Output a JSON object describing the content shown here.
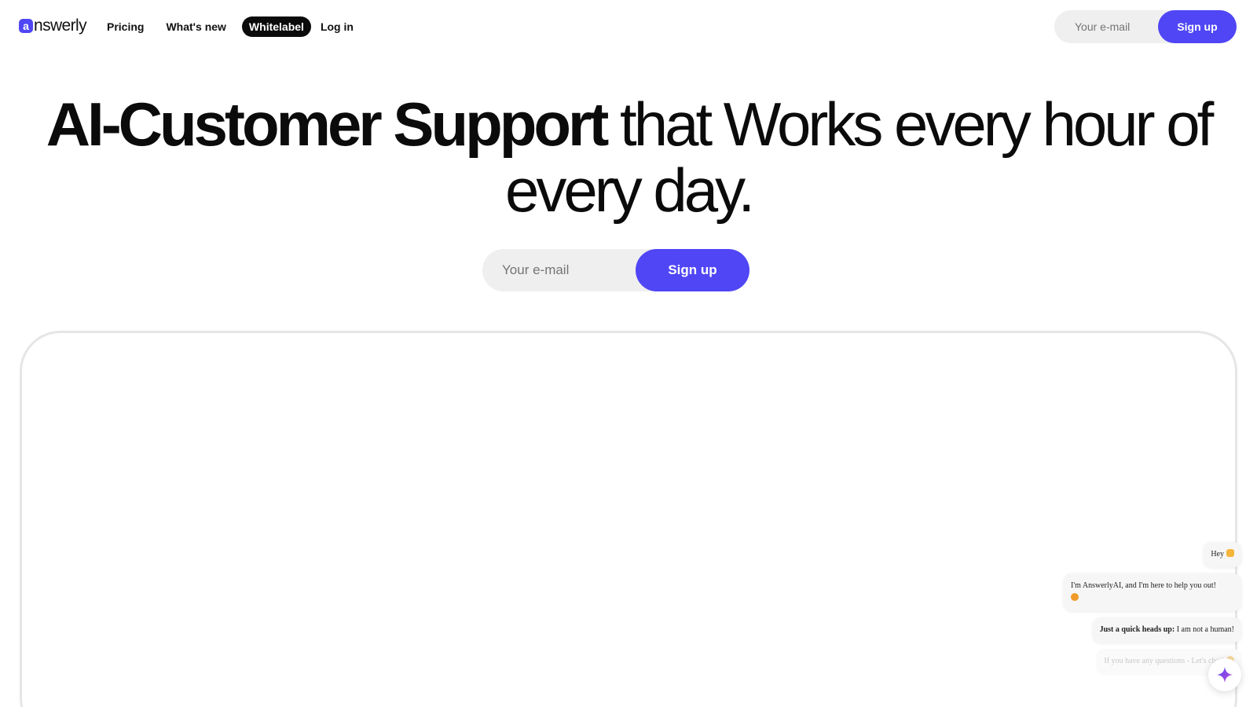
{
  "brand": {
    "logo_letter": "a",
    "logo_text": "nswerly",
    "accent": "#5046f5"
  },
  "nav": {
    "links": [
      {
        "label": "Pricing"
      },
      {
        "label": "What's new"
      },
      {
        "label": "Whitelabel"
      },
      {
        "label": "Log in"
      }
    ],
    "signup": {
      "email_placeholder": "Your e-mail",
      "button_label": "Sign up"
    }
  },
  "hero": {
    "title_strong": "AI-Customer Support",
    "title_rest": " that Works every hour of every day.",
    "signup": {
      "email_placeholder": "Your e-mail",
      "button_label": "Sign up"
    }
  },
  "chat": {
    "messages": [
      {
        "text": "Hey"
      },
      {
        "text": "I'm AnswerlyAI, and I'm here to help you out!"
      },
      {
        "bold": "Just a quick heads up:",
        "text": " I am not a human!"
      },
      {
        "text": "If you have any questions - Let's chat!"
      }
    ],
    "icons": {
      "launcher": "sparkle-icon"
    }
  }
}
